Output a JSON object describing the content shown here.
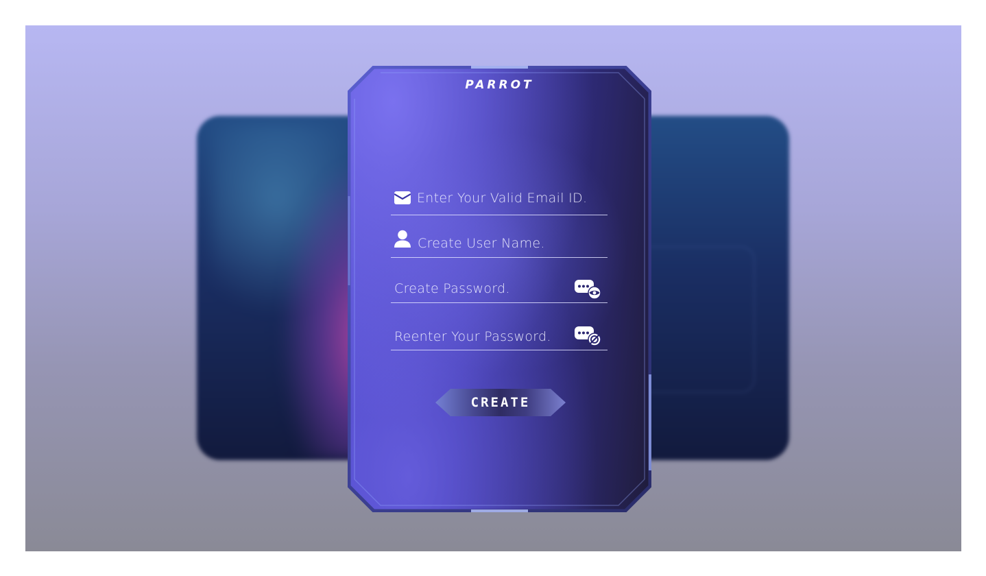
{
  "brand": {
    "name": "PARROT"
  },
  "form": {
    "email": {
      "placeholder": "Enter Your Valid Email ID.",
      "icon": "envelope-icon"
    },
    "username": {
      "placeholder": "Create User Name.",
      "icon": "user-icon"
    },
    "password": {
      "placeholder": "Create Password.",
      "icon": "show-password-icon"
    },
    "confirm_password": {
      "placeholder": "Reenter Your Password.",
      "icon": "hide-password-icon"
    },
    "submit_label": "CREATE"
  },
  "colors": {
    "accent": "#4a45c8",
    "card_dark": "#1f1c3a",
    "frame_highlight": "#8fa8ff",
    "background_top": "#b7b7f2",
    "background_bottom": "#8a8a96"
  }
}
